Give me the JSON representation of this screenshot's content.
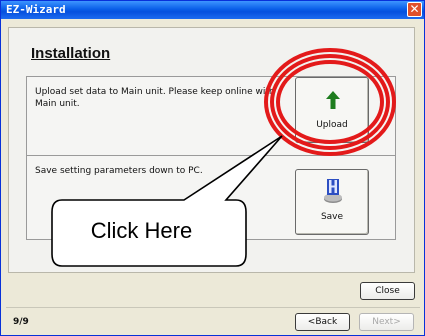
{
  "window": {
    "title": "EZ-Wizard",
    "close_glyph": "✕"
  },
  "page": {
    "heading": "Installation",
    "upload_section": {
      "description": "Upload set data to Main unit. Please keep online with Main unit.",
      "button_label": "Upload",
      "icon": "up-arrow-icon"
    },
    "save_section": {
      "description": "Save setting parameters down to PC.",
      "button_label": "Save",
      "icon": "save-disk-icon"
    }
  },
  "buttons": {
    "close": "Close",
    "back": "<Back",
    "next": "Next>"
  },
  "status": {
    "page_indicator": "9/9"
  },
  "annotation": {
    "callout_text": "Click Here",
    "highlight_color": "#e31a1a"
  },
  "colors": {
    "titlebar": "#0a5fe8",
    "arrow": "#1e7d1e",
    "window_bg": "#ece9d8"
  }
}
